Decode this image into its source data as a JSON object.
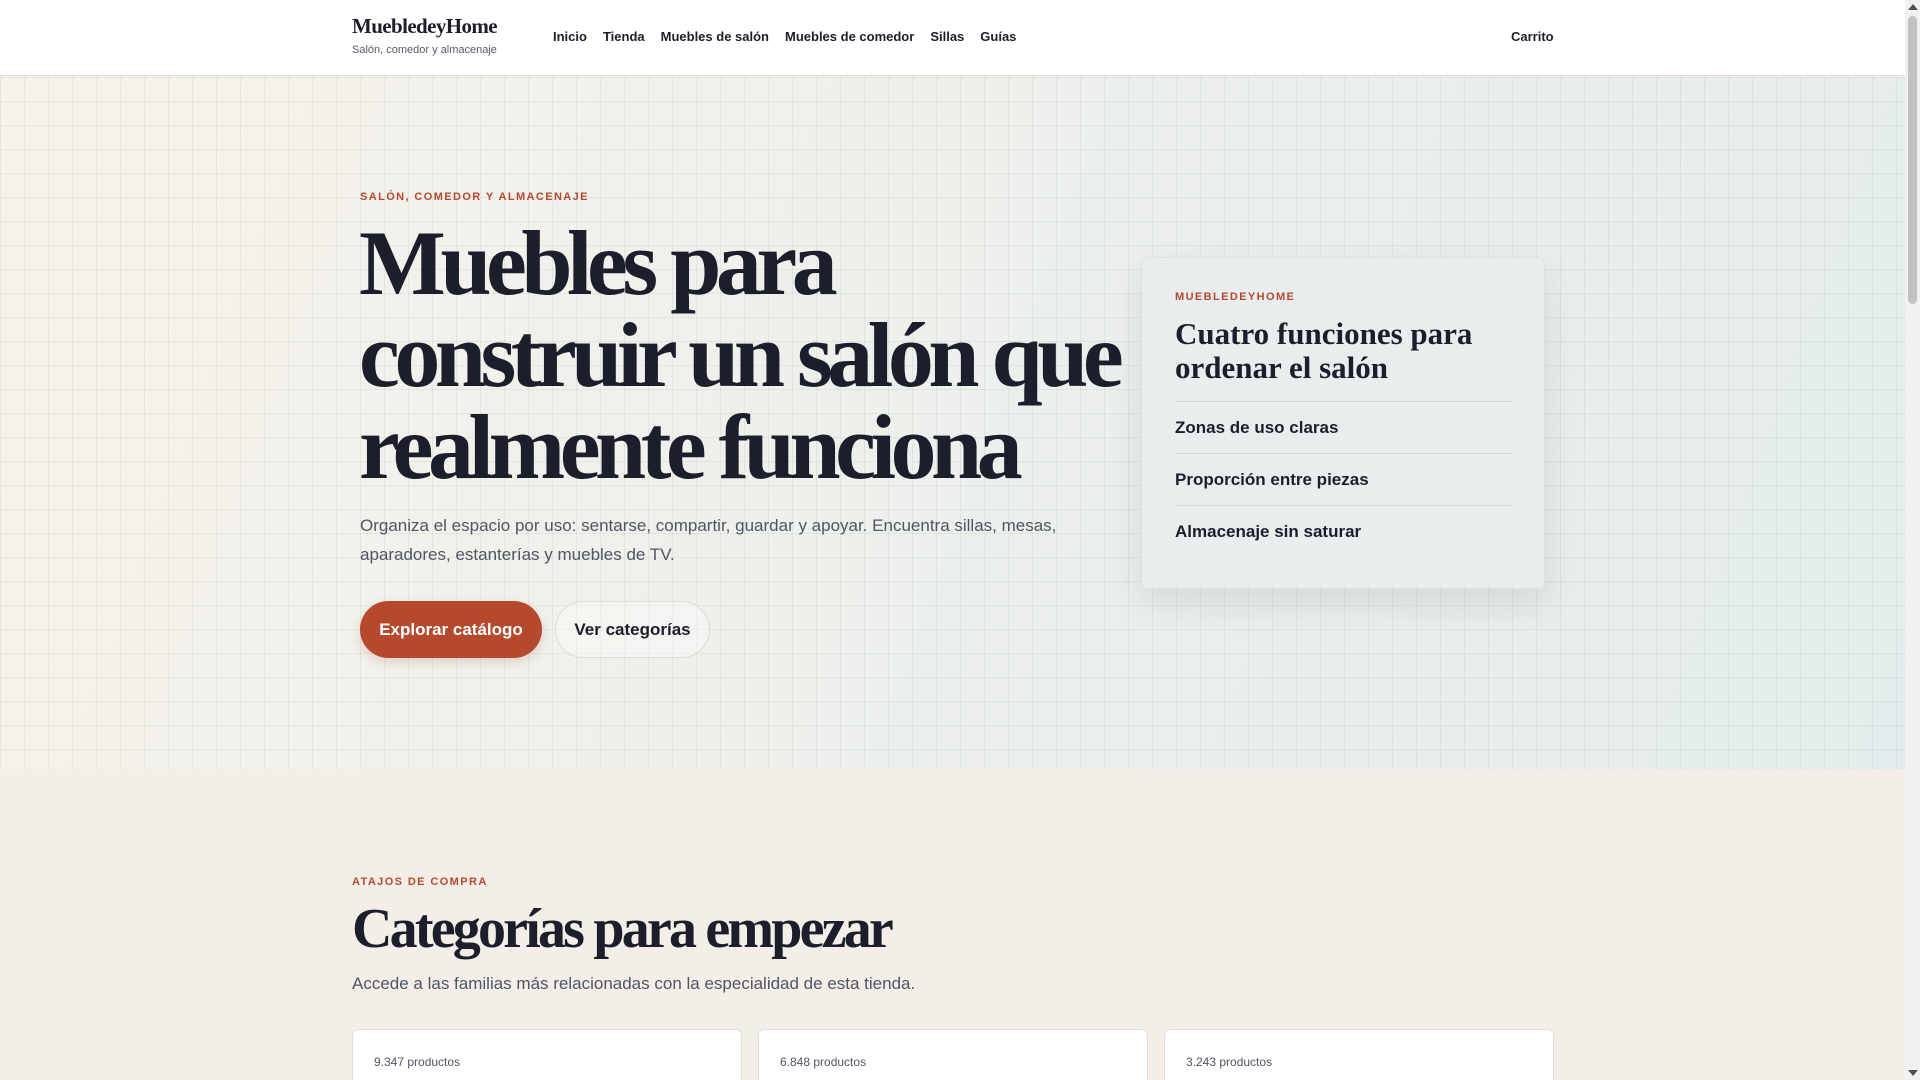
{
  "header": {
    "brand_name": "MuebledeyHome",
    "brand_tagline": "Salón, comedor y almacenaje",
    "nav": [
      {
        "label": "Inicio"
      },
      {
        "label": "Tienda"
      },
      {
        "label": "Muebles de salón"
      },
      {
        "label": "Muebles de comedor"
      },
      {
        "label": "Sillas"
      },
      {
        "label": "Guías"
      }
    ],
    "cart_label": "Carrito"
  },
  "hero": {
    "eyebrow": "SALÓN, COMEDOR Y ALMACENAJE",
    "title": "Muebles para construir un salón que realmente funciona",
    "description": "Organiza el espacio por uso: sentarse, compartir, guardar y apoyar. Encuentra sillas, mesas, aparadores, estanterías y muebles de TV.",
    "primary_button": "Explorar catálogo",
    "secondary_button": "Ver categorías"
  },
  "feature_card": {
    "eyebrow": "MUEBLEDEYHOME",
    "title": "Cuatro funciones para ordenar el salón",
    "items": [
      {
        "label": "Zonas de uso claras"
      },
      {
        "label": "Proporción entre piezas"
      },
      {
        "label": "Almacenaje sin saturar"
      }
    ]
  },
  "categories": {
    "eyebrow": "ATAJOS DE COMPRA",
    "title": "Categorías para empezar",
    "description": "Accede a las familias más relacionadas con la especialidad de esta tienda.",
    "cards": [
      {
        "count": "9.347 productos"
      },
      {
        "count": "6.848 productos"
      },
      {
        "count": "3.243 productos"
      }
    ]
  },
  "colors": {
    "accent": "#b4492e",
    "text": "#1c1f2b",
    "background": "#f3efe8"
  }
}
